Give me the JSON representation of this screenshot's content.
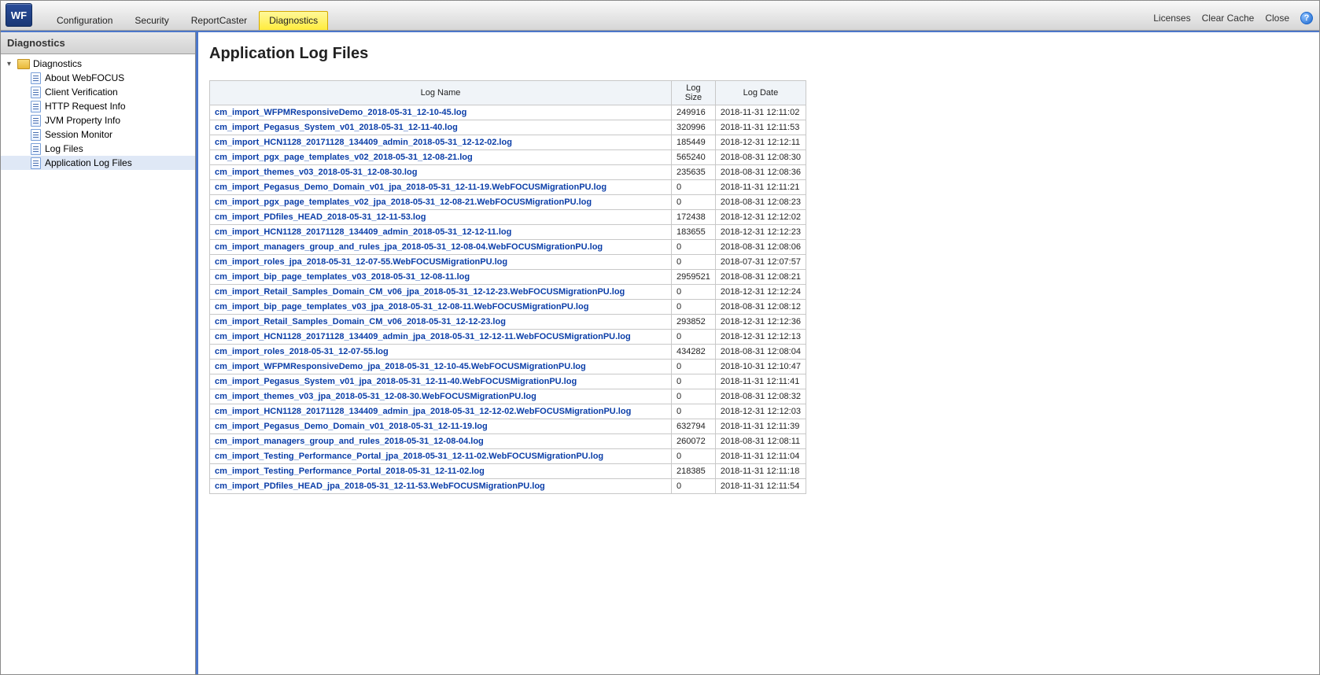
{
  "logo": "WF",
  "tabs": {
    "configuration": "Configuration",
    "security": "Security",
    "reportcaster": "ReportCaster",
    "diagnostics": "Diagnostics"
  },
  "topRight": {
    "licenses": "Licenses",
    "clearCache": "Clear Cache",
    "close": "Close"
  },
  "sidebar": {
    "header": "Diagnostics",
    "root": "Diagnostics",
    "items": [
      "About WebFOCUS",
      "Client Verification",
      "HTTP Request Info",
      "JVM Property Info",
      "Session Monitor",
      "Log Files",
      "Application Log Files"
    ]
  },
  "main": {
    "title": "Application Log Files",
    "columns": {
      "name": "Log Name",
      "size": "Log Size",
      "date": "Log Date"
    },
    "rows": [
      {
        "name": "cm_import_WFPMResponsiveDemo_2018-05-31_12-10-45.log",
        "size": "249916",
        "date": "2018-11-31 12:11:02"
      },
      {
        "name": "cm_import_Pegasus_System_v01_2018-05-31_12-11-40.log",
        "size": "320996",
        "date": "2018-11-31 12:11:53"
      },
      {
        "name": "cm_import_HCN1128_20171128_134409_admin_2018-05-31_12-12-02.log",
        "size": "185449",
        "date": "2018-12-31 12:12:11"
      },
      {
        "name": "cm_import_pgx_page_templates_v02_2018-05-31_12-08-21.log",
        "size": "565240",
        "date": "2018-08-31 12:08:30"
      },
      {
        "name": "cm_import_themes_v03_2018-05-31_12-08-30.log",
        "size": "235635",
        "date": "2018-08-31 12:08:36"
      },
      {
        "name": "cm_import_Pegasus_Demo_Domain_v01_jpa_2018-05-31_12-11-19.WebFOCUSMigrationPU.log",
        "size": "0",
        "date": "2018-11-31 12:11:21"
      },
      {
        "name": "cm_import_pgx_page_templates_v02_jpa_2018-05-31_12-08-21.WebFOCUSMigrationPU.log",
        "size": "0",
        "date": "2018-08-31 12:08:23"
      },
      {
        "name": "cm_import_PDfiles_HEAD_2018-05-31_12-11-53.log",
        "size": "172438",
        "date": "2018-12-31 12:12:02"
      },
      {
        "name": "cm_import_HCN1128_20171128_134409_admin_2018-05-31_12-12-11.log",
        "size": "183655",
        "date": "2018-12-31 12:12:23"
      },
      {
        "name": "cm_import_managers_group_and_rules_jpa_2018-05-31_12-08-04.WebFOCUSMigrationPU.log",
        "size": "0",
        "date": "2018-08-31 12:08:06"
      },
      {
        "name": "cm_import_roles_jpa_2018-05-31_12-07-55.WebFOCUSMigrationPU.log",
        "size": "0",
        "date": "2018-07-31 12:07:57"
      },
      {
        "name": "cm_import_bip_page_templates_v03_2018-05-31_12-08-11.log",
        "size": "2959521",
        "date": "2018-08-31 12:08:21"
      },
      {
        "name": "cm_import_Retail_Samples_Domain_CM_v06_jpa_2018-05-31_12-12-23.WebFOCUSMigrationPU.log",
        "size": "0",
        "date": "2018-12-31 12:12:24"
      },
      {
        "name": "cm_import_bip_page_templates_v03_jpa_2018-05-31_12-08-11.WebFOCUSMigrationPU.log",
        "size": "0",
        "date": "2018-08-31 12:08:12"
      },
      {
        "name": "cm_import_Retail_Samples_Domain_CM_v06_2018-05-31_12-12-23.log",
        "size": "293852",
        "date": "2018-12-31 12:12:36"
      },
      {
        "name": "cm_import_HCN1128_20171128_134409_admin_jpa_2018-05-31_12-12-11.WebFOCUSMigrationPU.log",
        "size": "0",
        "date": "2018-12-31 12:12:13"
      },
      {
        "name": "cm_import_roles_2018-05-31_12-07-55.log",
        "size": "434282",
        "date": "2018-08-31 12:08:04"
      },
      {
        "name": "cm_import_WFPMResponsiveDemo_jpa_2018-05-31_12-10-45.WebFOCUSMigrationPU.log",
        "size": "0",
        "date": "2018-10-31 12:10:47"
      },
      {
        "name": "cm_import_Pegasus_System_v01_jpa_2018-05-31_12-11-40.WebFOCUSMigrationPU.log",
        "size": "0",
        "date": "2018-11-31 12:11:41"
      },
      {
        "name": "cm_import_themes_v03_jpa_2018-05-31_12-08-30.WebFOCUSMigrationPU.log",
        "size": "0",
        "date": "2018-08-31 12:08:32"
      },
      {
        "name": "cm_import_HCN1128_20171128_134409_admin_jpa_2018-05-31_12-12-02.WebFOCUSMigrationPU.log",
        "size": "0",
        "date": "2018-12-31 12:12:03"
      },
      {
        "name": "cm_import_Pegasus_Demo_Domain_v01_2018-05-31_12-11-19.log",
        "size": "632794",
        "date": "2018-11-31 12:11:39"
      },
      {
        "name": "cm_import_managers_group_and_rules_2018-05-31_12-08-04.log",
        "size": "260072",
        "date": "2018-08-31 12:08:11"
      },
      {
        "name": "cm_import_Testing_Performance_Portal_jpa_2018-05-31_12-11-02.WebFOCUSMigrationPU.log",
        "size": "0",
        "date": "2018-11-31 12:11:04"
      },
      {
        "name": "cm_import_Testing_Performance_Portal_2018-05-31_12-11-02.log",
        "size": "218385",
        "date": "2018-11-31 12:11:18"
      },
      {
        "name": "cm_import_PDfiles_HEAD_jpa_2018-05-31_12-11-53.WebFOCUSMigrationPU.log",
        "size": "0",
        "date": "2018-11-31 12:11:54"
      }
    ]
  }
}
